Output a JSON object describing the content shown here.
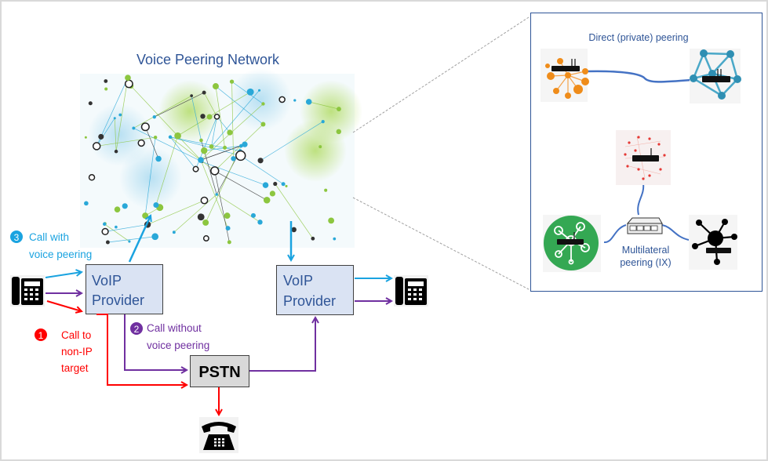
{
  "diagram": {
    "title": "Voice Peering Network",
    "colors": {
      "title_blue": "#2f5597",
      "cyan": "#1aa3e0",
      "purple": "#7030a0",
      "red": "#ff0000",
      "box_fill": "#dae3f3",
      "box_border": "#404040",
      "pstn_fill": "#d9d9d9",
      "inset_border": "#2f5597",
      "link_blue": "#4472c4"
    },
    "nodes": {
      "voip_left": {
        "line1": "VoIP",
        "line2": "Provider"
      },
      "voip_right": {
        "line1": "VoIP",
        "line2": "Provider"
      },
      "pstn": {
        "label": "PSTN"
      }
    },
    "annotations": {
      "call3": {
        "badge": "3",
        "line1": "Call with",
        "line2": "voice peering"
      },
      "call2": {
        "badge": "2",
        "line1": "Call without",
        "line2": "voice peering"
      },
      "call1": {
        "badge": "1",
        "line1": "Call to",
        "line2": "non-IP",
        "line3": "target"
      }
    },
    "inset": {
      "direct_label": "Direct (private) peering",
      "ix_label_line1": "Multilateral",
      "ix_label_line2": "peering (IX)"
    }
  }
}
